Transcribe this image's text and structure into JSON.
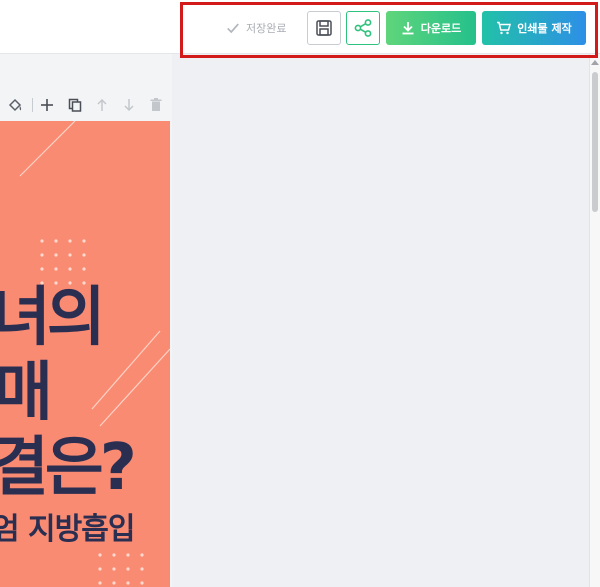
{
  "toolbar": {
    "saved_status": "저장완료",
    "save_icon": "floppy-disk-icon",
    "share_icon": "share-icon",
    "download_label": "다운로드",
    "print_label": "인쇄물 제작"
  },
  "canvas_tools": [
    "paint-bucket-icon",
    "plus-icon",
    "copy-icon",
    "arrow-up-icon",
    "arrow-down-icon",
    "trash-icon"
  ],
  "design": {
    "line1": "녀의",
    "line2": "매",
    "line3": "결은?",
    "line4": "엄 지방흡입"
  },
  "colors": {
    "highlight": "#d21a1a",
    "design_bg": "#f98b73",
    "headline": "#2a2f52",
    "download_from": "#5fd57b",
    "download_to": "#25c08b",
    "print_from": "#22c1a8",
    "print_to": "#2d8fe6"
  }
}
